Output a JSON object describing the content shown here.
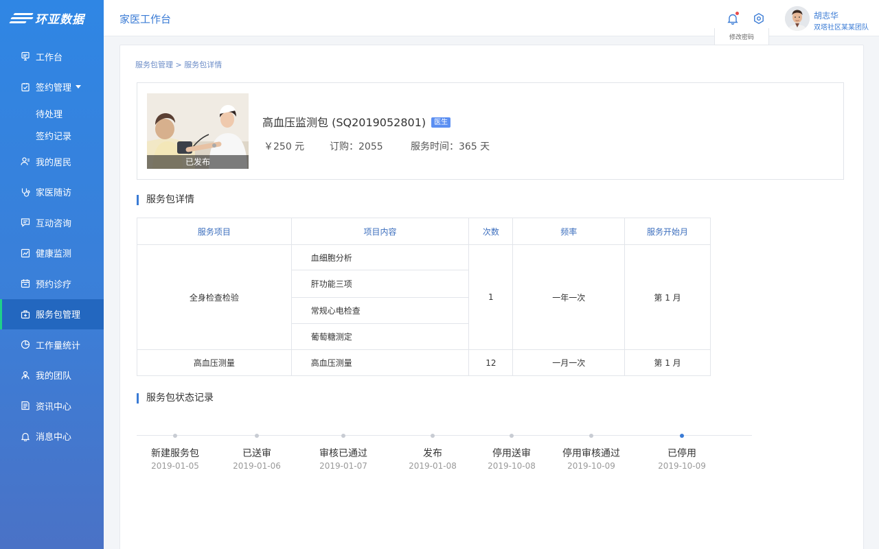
{
  "app": {
    "logo": "环亚数据",
    "title": "家医工作台"
  },
  "user": {
    "name": "胡志华",
    "team": "双塔社区某某团队",
    "menu_item": "修改密码"
  },
  "sidebar": {
    "items": [
      {
        "label": "工作台",
        "icon": "desk-icon"
      },
      {
        "label": "签约管理",
        "icon": "sign-icon",
        "sub": [
          "待处理",
          "签约记录"
        ]
      },
      {
        "label": "我的居民",
        "icon": "residents-icon"
      },
      {
        "label": "家医随访",
        "icon": "stethoscope-icon"
      },
      {
        "label": "互动咨询",
        "icon": "chat-icon"
      },
      {
        "label": "健康监测",
        "icon": "chart-icon"
      },
      {
        "label": "预约诊疗",
        "icon": "calendar-icon"
      },
      {
        "label": "服务包管理",
        "icon": "package-icon",
        "active": true
      },
      {
        "label": "工作量统计",
        "icon": "pie-icon"
      },
      {
        "label": "我的团队",
        "icon": "team-icon"
      },
      {
        "label": "资讯中心",
        "icon": "news-icon"
      },
      {
        "label": "消息中心",
        "icon": "bell-icon"
      }
    ]
  },
  "breadcrumb": "服务包管理 > 服务包详情",
  "package": {
    "image_label": "已发布",
    "name": "高血压监测包 (SQ2019052801)",
    "tag": "医生",
    "price": "￥250 元",
    "orders": "订购：2055",
    "duration": "服务时间：365 天"
  },
  "detail": {
    "title": "服务包详情",
    "headers": [
      "服务项目",
      "项目内容",
      "次数",
      "频率",
      "服务开始月"
    ],
    "groups": [
      {
        "item": "全身检查检验",
        "contents": [
          "血细胞分析",
          "肝功能三项",
          "常规心电检查",
          "葡萄糖测定"
        ],
        "count": "1",
        "freq": "一年一次",
        "start": "第 1 月"
      },
      {
        "item": "高血压测量",
        "contents": [
          "高血压测量"
        ],
        "count": "12",
        "freq": "一月一次",
        "start": "第 1 月"
      }
    ]
  },
  "status": {
    "title": "服务包状态记录",
    "steps": [
      {
        "label": "新建服务包",
        "date": "2019-01-05"
      },
      {
        "label": "已送审",
        "date": "2019-01-06"
      },
      {
        "label": "审核已通过",
        "date": "2019-01-07"
      },
      {
        "label": "发布",
        "date": "2019-01-08"
      },
      {
        "label": "停用送审",
        "date": "2019-10-08"
      },
      {
        "label": "停用审核通过",
        "date": "2019-10-09"
      },
      {
        "label": "已停用",
        "date": "2019-10-09",
        "current": true
      }
    ]
  },
  "colors": {
    "accent": "#3a7bd5",
    "sidebar_active": "#2367bf",
    "active_bar": "#1fd08a"
  }
}
